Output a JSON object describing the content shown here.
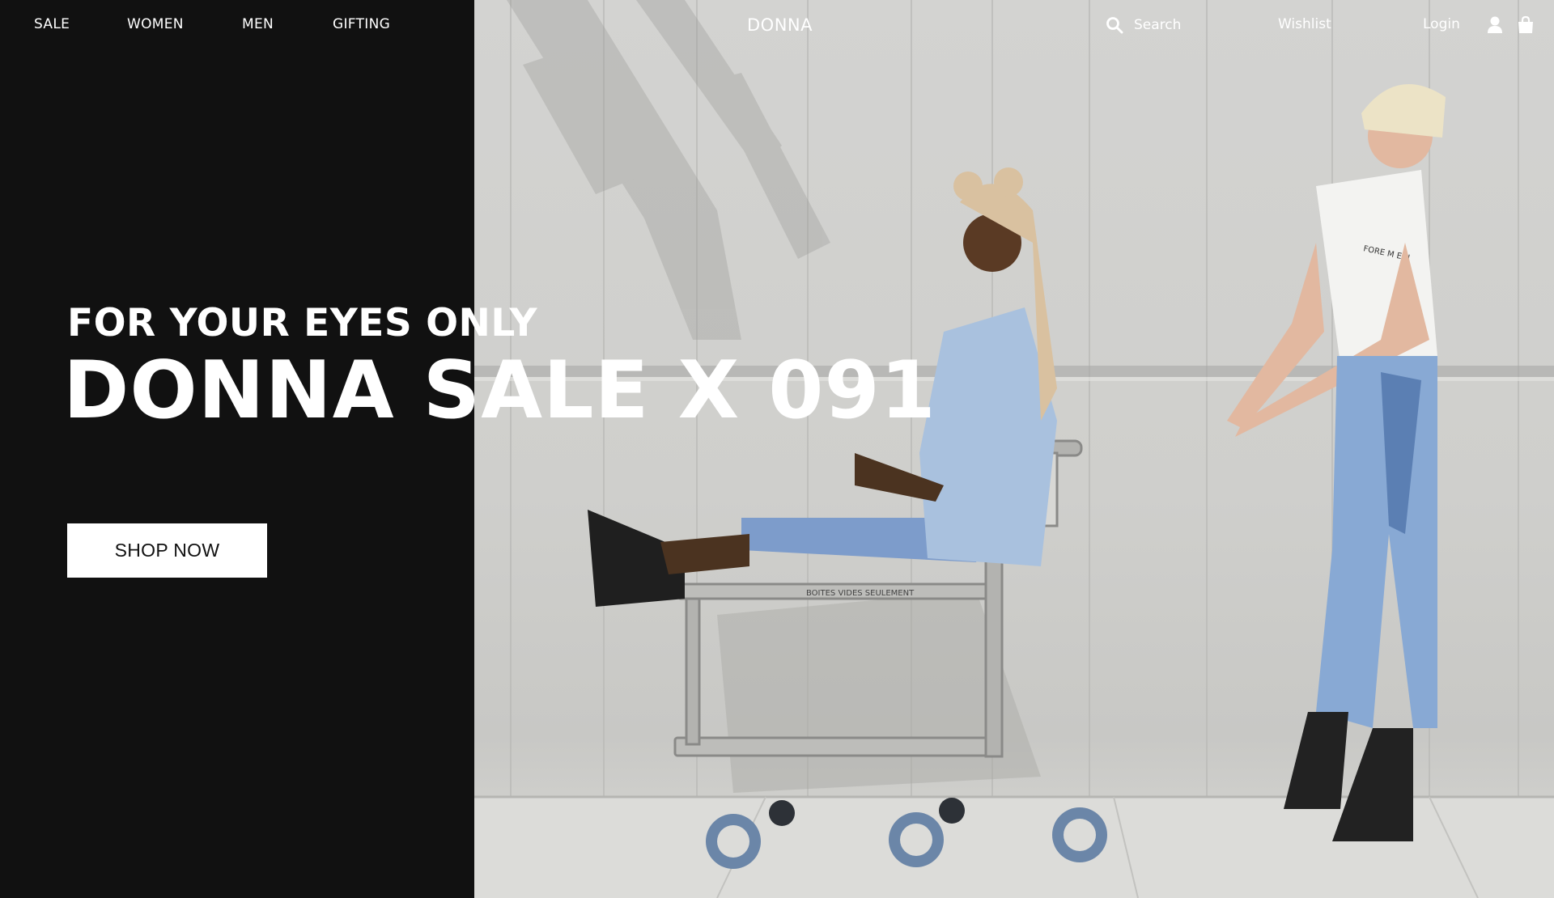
{
  "nav": {
    "items": [
      {
        "label": "SALE"
      },
      {
        "label": "WOMEN"
      },
      {
        "label": "MEN"
      },
      {
        "label": "GIFTING"
      }
    ],
    "brand": "DONNA",
    "search": {
      "icon": "search-icon",
      "placeholder": "Search"
    },
    "wishlist": "Wishlist",
    "login": "Login",
    "user_icon": "user-icon",
    "bag_icon": "shopping-bag-icon"
  },
  "hero": {
    "kicker": "FOR YOUR EYES ONLY",
    "title": "DONNA SALE X 091",
    "cta": "SHOP NOW",
    "cart_label": "BOITES VIDES SEULEMENT",
    "tshirt_text": "FORE M  EUI"
  },
  "colors": {
    "panel": "#111111",
    "text": "#ffffff",
    "button_bg": "#ffffff",
    "button_text": "#111111"
  }
}
